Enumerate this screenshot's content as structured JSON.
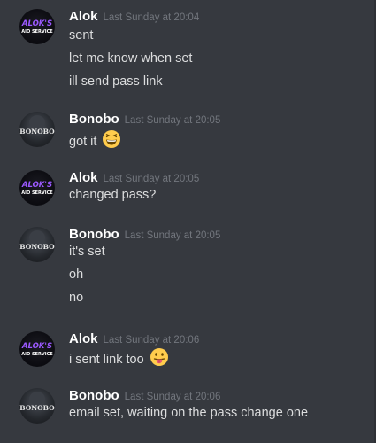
{
  "messages": [
    {
      "author": "Alok",
      "timestamp": "Last Sunday at 20:04",
      "avatar_icon": "aloks-aio-service-logo",
      "avatar_text": [
        "ALOK'S",
        "AIO SERVICE"
      ],
      "lines": [
        "sent",
        "let me know when set",
        "ill send pass link"
      ]
    },
    {
      "author": "Bonobo",
      "timestamp": "Last Sunday at 20:05",
      "avatar_icon": "bonobo-logo",
      "avatar_text": [
        "BONOBO"
      ],
      "lines": [
        "got it"
      ],
      "emoji": "grinning-squinting-face"
    },
    {
      "author": "Alok",
      "timestamp": "Last Sunday at 20:05",
      "avatar_icon": "aloks-aio-service-logo",
      "avatar_text": [
        "ALOK'S",
        "AIO SERVICE"
      ],
      "lines": [
        "changed pass?"
      ]
    },
    {
      "author": "Bonobo",
      "timestamp": "Last Sunday at 20:05",
      "avatar_icon": "bonobo-logo",
      "avatar_text": [
        "BONOBO"
      ],
      "lines": [
        "it's set",
        "oh",
        "no"
      ]
    },
    {
      "author": "Alok",
      "timestamp": "Last Sunday at 20:06",
      "avatar_icon": "aloks-aio-service-logo",
      "avatar_text": [
        "ALOK'S",
        "AIO SERVICE"
      ],
      "lines": [
        "i sent link too"
      ],
      "emoji": "face-with-tongue"
    },
    {
      "author": "Bonobo",
      "timestamp": "Last Sunday at 20:06",
      "avatar_icon": "bonobo-logo",
      "avatar_text": [
        "BONOBO"
      ],
      "lines": [
        "email set, waiting on the pass change one"
      ]
    }
  ],
  "colors": {
    "background": "#36393f",
    "username": "#ffffff",
    "timestamp": "#72767d",
    "message_text": "#dcddde",
    "alok_logo": "#9b59ff",
    "emoji_yellow": "#ffcc4d"
  }
}
